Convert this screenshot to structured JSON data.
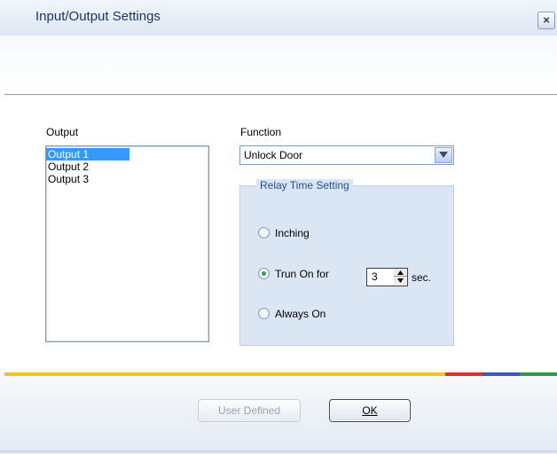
{
  "window": {
    "title": "Input/Output Settings",
    "close_symbol": "×"
  },
  "output": {
    "label": "Output",
    "items": [
      "Output 1",
      "Output 2",
      "Output 3"
    ],
    "selected_index": 0
  },
  "function": {
    "label": "Function",
    "selected": "Unlock Door"
  },
  "relay": {
    "legend": "Relay Time Setting",
    "options": [
      {
        "label": "Inching",
        "checked": false
      },
      {
        "label": "Trun On for",
        "checked": true
      },
      {
        "label": "Always On",
        "checked": false
      }
    ],
    "duration_value": "3",
    "duration_unit": "sec."
  },
  "buttons": {
    "user_defined": "User Defined",
    "ok": "OK"
  },
  "colors": {
    "accent_strip": [
      "#f4c419",
      "#e0312a",
      "#3b57c4",
      "#2e9a45"
    ],
    "selection": "#3399ff",
    "legend_text": "#1e4f9c"
  }
}
